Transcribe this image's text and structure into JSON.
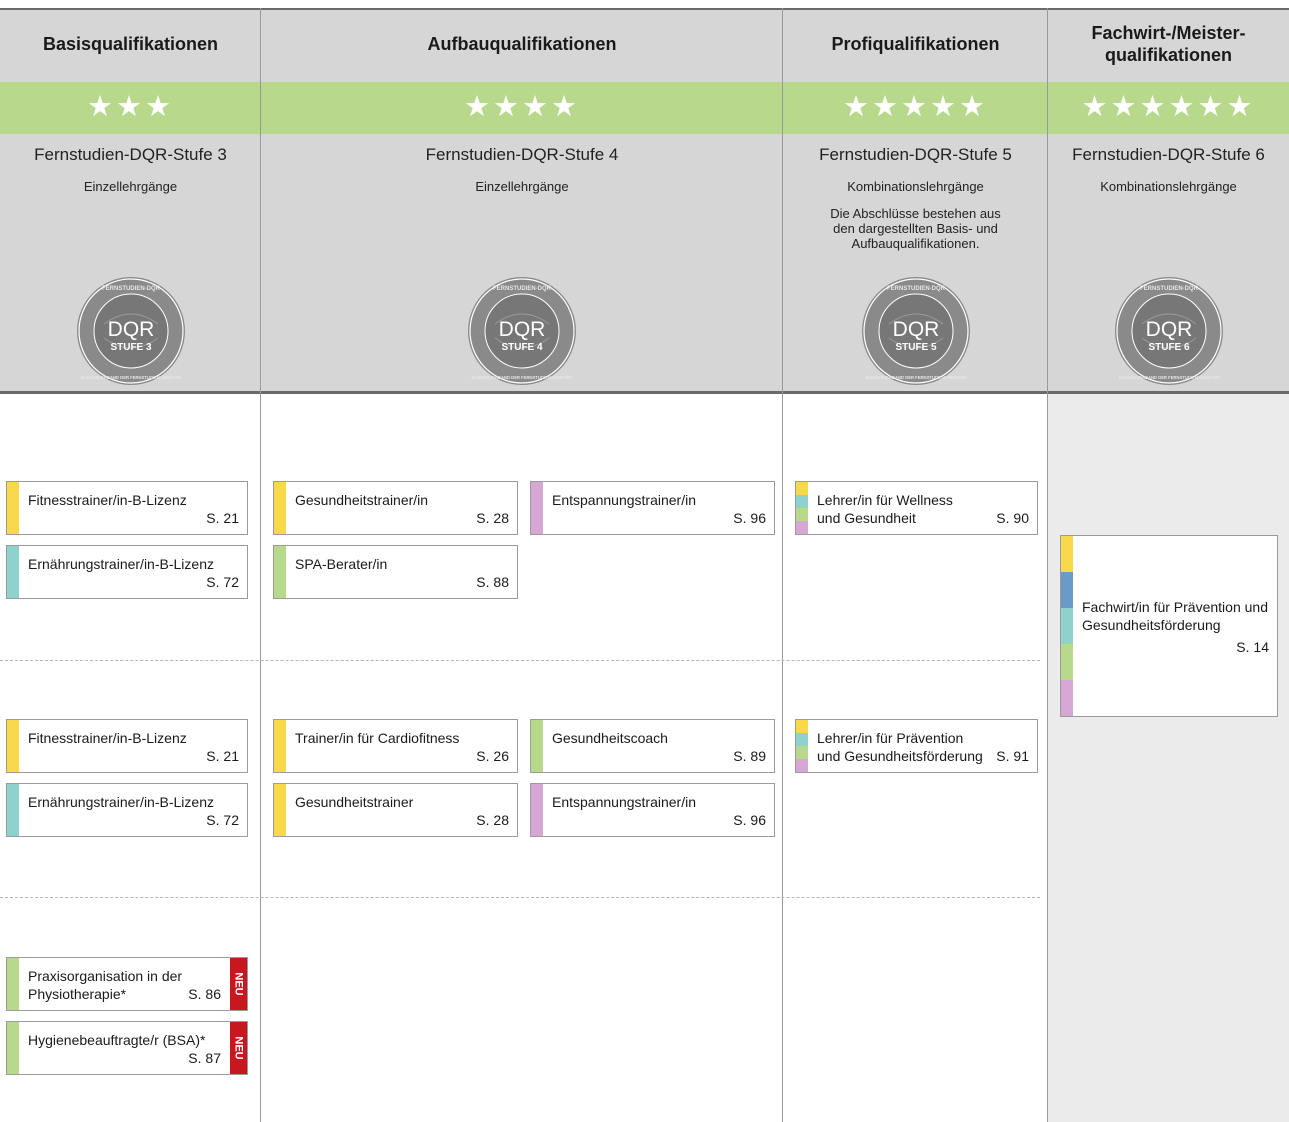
{
  "colors": {
    "yellow": "#f9d84a",
    "teal": "#8fd1cc",
    "green": "#b8d98c",
    "pink": "#d7a7d3",
    "blue": "#6a9bc8",
    "neu_red": "#c8171e",
    "header_bg": "#d6d6d6",
    "star_bar": "#b8d98c"
  },
  "columns": [
    {
      "title": "Basisqualifikationen",
      "stars": "★★★",
      "level": "Fernstudien-DQR-Stufe 3",
      "sublevel": "Einzellehrgänge",
      "note": "",
      "seal": {
        "ring_top": "FERNSTUDIEN-DQR",
        "ring_bottom": "BUNDESVERBAND DER FERNSTUDIENANBIETER",
        "main": "DQR",
        "stufe": "STUFE 3"
      }
    },
    {
      "title": "Aufbauqualifikationen",
      "stars": "★★★★",
      "level": "Fernstudien-DQR-Stufe 4",
      "sublevel": "Einzellehrgänge",
      "note": "",
      "seal": {
        "ring_top": "FERNSTUDIEN-DQR",
        "ring_bottom": "BUNDESVERBAND DER FERNSTUDIENANBIETER",
        "main": "DQR",
        "stufe": "STUFE 4"
      }
    },
    {
      "title": "Profiqualifikationen",
      "stars": "★★★★★",
      "level": "Fernstudien-DQR-Stufe 5",
      "sublevel": "Kombinationslehrgänge",
      "note": "Die Abschlüsse bestehen aus den dargestellten Basis- und Aufbauqualifikationen.",
      "seal": {
        "ring_top": "FERNSTUDIEN-DQR",
        "ring_bottom": "BUNDESVERBAND DER FERNSTUDIENANBIETER",
        "main": "DQR",
        "stufe": "STUFE 5"
      }
    },
    {
      "title": "Fachwirt-/Meister-qualifikationen",
      "stars": "★★★★★★",
      "level": "Fernstudien-DQR-Stufe 6",
      "sublevel": "Kombinationslehrgänge",
      "note": "",
      "seal": {
        "ring_top": "FERNSTUDIEN-DQR",
        "ring_bottom": "BUNDESVERBAND DER FERNSTUDIENANBIETER",
        "main": "DQR",
        "stufe": "STUFE 6"
      }
    }
  ],
  "courses": [
    {
      "title": "Fitnesstrainer/in-B-Lizenz",
      "page": "S. 21",
      "colors": [
        "yellow"
      ],
      "neu": false
    },
    {
      "title": "Ernährungstrainer/in-B-Lizenz",
      "page": "S. 72",
      "colors": [
        "teal"
      ],
      "neu": false
    },
    {
      "title": "Gesundheitstrainer/in",
      "page": "S. 28",
      "colors": [
        "yellow"
      ],
      "neu": false
    },
    {
      "title": "Entspannungstrainer/in",
      "page": "S. 96",
      "colors": [
        "pink"
      ],
      "neu": false
    },
    {
      "title": "SPA-Berater/in",
      "page": "S. 88",
      "colors": [
        "green"
      ],
      "neu": false
    },
    {
      "title": "Lehrer/in für Wellness und Gesundheit",
      "page": "S. 90",
      "colors": [
        "yellow",
        "teal",
        "green",
        "pink"
      ],
      "neu": false
    },
    {
      "title": "Fachwirt/in für Prävention und Gesundheitsförderung",
      "page": "S. 14",
      "colors": [
        "yellow",
        "blue",
        "teal",
        "green",
        "pink"
      ],
      "neu": false
    },
    {
      "title": "Fitnesstrainer/in-B-Lizenz",
      "page": "S. 21",
      "colors": [
        "yellow"
      ],
      "neu": false
    },
    {
      "title": "Ernährungstrainer/in-B-Lizenz",
      "page": "S. 72",
      "colors": [
        "teal"
      ],
      "neu": false
    },
    {
      "title": "Trainer/in für Cardiofitness",
      "page": "S. 26",
      "colors": [
        "yellow"
      ],
      "neu": false
    },
    {
      "title": "Gesundheitscoach",
      "page": "S. 89",
      "colors": [
        "green"
      ],
      "neu": false
    },
    {
      "title": "Gesundheitstrainer",
      "page": "S. 28",
      "colors": [
        "yellow"
      ],
      "neu": false
    },
    {
      "title": "Entspannungstrainer/in",
      "page": "S. 96",
      "colors": [
        "pink"
      ],
      "neu": false
    },
    {
      "title": "Lehrer/in für Prävention und Gesundheitsförderung",
      "page": "S. 91",
      "colors": [
        "yellow",
        "teal",
        "green",
        "pink"
      ],
      "neu": false
    },
    {
      "title": "Praxisorganisation in der Physiotherapie*",
      "page": "S. 86",
      "colors": [
        "green"
      ],
      "neu": true,
      "neu_label": "NEU"
    },
    {
      "title": "Hygienebeauftragte/r (BSA)*",
      "page": "S. 87",
      "colors": [
        "green"
      ],
      "neu": true,
      "neu_label": "NEU"
    }
  ]
}
